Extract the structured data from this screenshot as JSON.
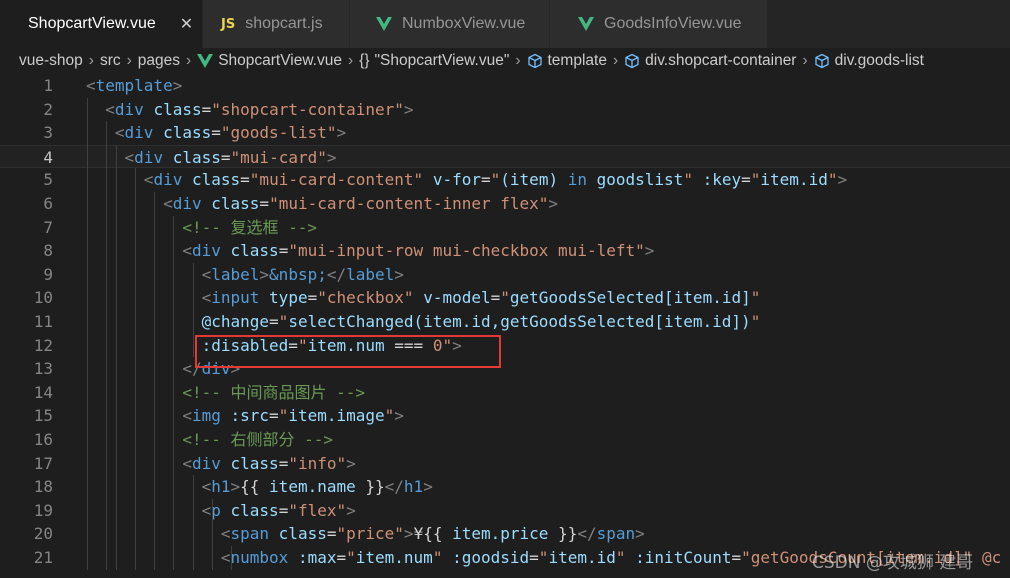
{
  "tabs": [
    {
      "label": "ShopcartView.vue",
      "type": "vue",
      "active": true,
      "close": "✕"
    },
    {
      "label": "shopcart.js",
      "type": "js",
      "active": false
    },
    {
      "label": "NumboxView.vue",
      "type": "vue",
      "active": false
    },
    {
      "label": "GoodsInfoView.vue",
      "type": "vue",
      "active": false
    }
  ],
  "js_badge": "JS",
  "breadcrumb": {
    "items": [
      "vue-shop",
      "src",
      "pages",
      "ShopcartView.vue",
      "\"ShopcartView.vue\"",
      "template",
      "div.shopcart-container",
      "div.goods-list"
    ],
    "braces": "{}"
  },
  "colors": {
    "vue_green": "#41b883",
    "highlight_red": "#e53935",
    "tag": "#569cd6",
    "attr": "#9cdcfe",
    "string": "#ce9178",
    "comment": "#6a9955"
  },
  "current_line": 4,
  "lines": [
    {
      "n": "1",
      "tokens": [
        [
          "t",
          "<"
        ],
        [
          "tag",
          "template"
        ],
        [
          "t",
          ">"
        ]
      ]
    },
    {
      "n": "2",
      "tokens": [
        [
          "t",
          "  <"
        ],
        [
          "tag",
          "div"
        ],
        [
          "txt",
          " "
        ],
        [
          "attr",
          "class"
        ],
        [
          "txt",
          "="
        ],
        [
          "str",
          "\"shopcart-container\""
        ],
        [
          "t",
          ">"
        ]
      ]
    },
    {
      "n": "3",
      "tokens": [
        [
          "t",
          "   <"
        ],
        [
          "tag",
          "div"
        ],
        [
          "txt",
          " "
        ],
        [
          "attr",
          "class"
        ],
        [
          "txt",
          "="
        ],
        [
          "str",
          "\"goods-list\""
        ],
        [
          "t",
          ">"
        ]
      ]
    },
    {
      "n": "4",
      "tokens": [
        [
          "t",
          "    <"
        ],
        [
          "tag",
          "div"
        ],
        [
          "txt",
          " "
        ],
        [
          "attr",
          "class"
        ],
        [
          "txt",
          "="
        ],
        [
          "str",
          "\"mui-card\""
        ],
        [
          "t",
          ">"
        ]
      ]
    },
    {
      "n": "5",
      "tokens": [
        [
          "t",
          "      <"
        ],
        [
          "tag",
          "div"
        ],
        [
          "txt",
          " "
        ],
        [
          "attr",
          "class"
        ],
        [
          "txt",
          "="
        ],
        [
          "str",
          "\"mui-card-content\""
        ],
        [
          "txt",
          " "
        ],
        [
          "attr",
          "v-for"
        ],
        [
          "txt",
          "="
        ],
        [
          "str",
          "\""
        ],
        [
          "attr",
          "(item) "
        ],
        [
          "tag",
          "in"
        ],
        [
          "attr",
          " goodslist"
        ],
        [
          "str",
          "\""
        ],
        [
          "txt",
          " "
        ],
        [
          "attr",
          ":key"
        ],
        [
          "txt",
          "="
        ],
        [
          "str",
          "\""
        ],
        [
          "attr",
          "item.id"
        ],
        [
          "str",
          "\""
        ],
        [
          "t",
          ">"
        ]
      ]
    },
    {
      "n": "6",
      "tokens": [
        [
          "t",
          "        <"
        ],
        [
          "tag",
          "div"
        ],
        [
          "txt",
          " "
        ],
        [
          "attr",
          "class"
        ],
        [
          "txt",
          "="
        ],
        [
          "str",
          "\"mui-card-content-inner flex\""
        ],
        [
          "t",
          ">"
        ]
      ]
    },
    {
      "n": "7",
      "tokens": [
        [
          "cmt",
          "          <!-- 复选框 -->"
        ]
      ]
    },
    {
      "n": "8",
      "tokens": [
        [
          "t",
          "          <"
        ],
        [
          "tag",
          "div"
        ],
        [
          "txt",
          " "
        ],
        [
          "attr",
          "class"
        ],
        [
          "txt",
          "="
        ],
        [
          "str",
          "\"mui-input-row mui-checkbox mui-left\""
        ],
        [
          "t",
          ">"
        ]
      ]
    },
    {
      "n": "9",
      "tokens": [
        [
          "t",
          "            <"
        ],
        [
          "tag",
          "label"
        ],
        [
          "t",
          ">"
        ],
        [
          "ent",
          "&nbsp;"
        ],
        [
          "t",
          "</"
        ],
        [
          "tag",
          "label"
        ],
        [
          "t",
          ">"
        ]
      ]
    },
    {
      "n": "10",
      "tokens": [
        [
          "t",
          "            <"
        ],
        [
          "tag",
          "input"
        ],
        [
          "txt",
          " "
        ],
        [
          "attr",
          "type"
        ],
        [
          "txt",
          "="
        ],
        [
          "str",
          "\"checkbox\""
        ],
        [
          "txt",
          " "
        ],
        [
          "attr",
          "v-model"
        ],
        [
          "txt",
          "="
        ],
        [
          "str",
          "\""
        ],
        [
          "attr",
          "getGoodsSelected[item.id]"
        ],
        [
          "str",
          "\""
        ]
      ]
    },
    {
      "n": "11",
      "tokens": [
        [
          "attr",
          "            @change"
        ],
        [
          "txt",
          "="
        ],
        [
          "str",
          "\""
        ],
        [
          "attr",
          "selectChanged(item.id,getGoodsSelected[item.id])"
        ],
        [
          "str",
          "\""
        ]
      ]
    },
    {
      "n": "12",
      "tokens": [
        [
          "attr",
          "            :disabled"
        ],
        [
          "txt",
          "="
        ],
        [
          "str",
          "\""
        ],
        [
          "attr",
          "item.num "
        ],
        [
          "txt",
          "=== "
        ],
        [
          "str",
          "0"
        ],
        [
          "str",
          "\""
        ],
        [
          "t",
          ">"
        ]
      ]
    },
    {
      "n": "13",
      "tokens": [
        [
          "t",
          "          </"
        ],
        [
          "tag",
          "div"
        ],
        [
          "t",
          ">"
        ]
      ]
    },
    {
      "n": "14",
      "tokens": [
        [
          "cmt",
          "          <!-- 中间商品图片 -->"
        ]
      ]
    },
    {
      "n": "15",
      "tokens": [
        [
          "t",
          "          <"
        ],
        [
          "tag",
          "img"
        ],
        [
          "txt",
          " "
        ],
        [
          "attr",
          ":src"
        ],
        [
          "txt",
          "="
        ],
        [
          "str",
          "\""
        ],
        [
          "attr",
          "item.image"
        ],
        [
          "str",
          "\""
        ],
        [
          "t",
          ">"
        ]
      ]
    },
    {
      "n": "16",
      "tokens": [
        [
          "cmt",
          "          <!-- 右侧部分 -->"
        ]
      ]
    },
    {
      "n": "17",
      "tokens": [
        [
          "t",
          "          <"
        ],
        [
          "tag",
          "div"
        ],
        [
          "txt",
          " "
        ],
        [
          "attr",
          "class"
        ],
        [
          "txt",
          "="
        ],
        [
          "str",
          "\"info\""
        ],
        [
          "t",
          ">"
        ]
      ]
    },
    {
      "n": "18",
      "tokens": [
        [
          "t",
          "            <"
        ],
        [
          "tag",
          "h1"
        ],
        [
          "t",
          ">"
        ],
        [
          "txt",
          "{{ "
        ],
        [
          "attr",
          "item.name"
        ],
        [
          "txt",
          " }}"
        ],
        [
          "t",
          "</"
        ],
        [
          "tag",
          "h1"
        ],
        [
          "t",
          ">"
        ]
      ]
    },
    {
      "n": "19",
      "tokens": [
        [
          "t",
          "            <"
        ],
        [
          "tag",
          "p"
        ],
        [
          "txt",
          " "
        ],
        [
          "attr",
          "class"
        ],
        [
          "txt",
          "="
        ],
        [
          "str",
          "\"flex\""
        ],
        [
          "t",
          ">"
        ]
      ]
    },
    {
      "n": "20",
      "tokens": [
        [
          "t",
          "              <"
        ],
        [
          "tag",
          "span"
        ],
        [
          "txt",
          " "
        ],
        [
          "attr",
          "class"
        ],
        [
          "txt",
          "="
        ],
        [
          "str",
          "\"price\""
        ],
        [
          "t",
          ">"
        ],
        [
          "txt",
          "¥{{ "
        ],
        [
          "attr",
          "item.price"
        ],
        [
          "txt",
          " }}"
        ],
        [
          "t",
          "</"
        ],
        [
          "tag",
          "span"
        ],
        [
          "t",
          ">"
        ]
      ]
    },
    {
      "n": "21",
      "tokens": [
        [
          "t",
          "              <"
        ],
        [
          "tag",
          "numbox"
        ],
        [
          "txt",
          " "
        ],
        [
          "attr",
          ":max"
        ],
        [
          "txt",
          "="
        ],
        [
          "str",
          "\""
        ],
        [
          "attr",
          "item.num"
        ],
        [
          "str",
          "\""
        ],
        [
          "txt",
          " "
        ],
        [
          "attr",
          ":goodsid"
        ],
        [
          "txt",
          "="
        ],
        [
          "str",
          "\""
        ],
        [
          "attr",
          "item.id"
        ],
        [
          "str",
          "\""
        ],
        [
          "txt",
          " "
        ],
        [
          "attr",
          ":initCount"
        ],
        [
          "txt",
          "="
        ],
        [
          "str",
          "\"getGoodsCount[item.id]\" @c"
        ]
      ]
    }
  ],
  "watermark": "CSDN @攻城狮 建哥"
}
